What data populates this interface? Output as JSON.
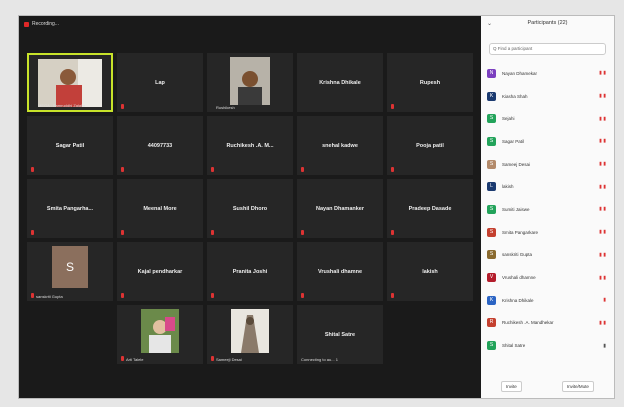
{
  "recording": {
    "label": "Recording..."
  },
  "panel": {
    "title": "Participants (22)",
    "search_placeholder": "Q Find a participant",
    "invite_label": "Invite",
    "more_label": "Invite/Mute"
  },
  "tiles": [
    {
      "name": "MEGA : Samruddhi Zalake",
      "caption": true
    },
    {
      "name": "Lap"
    },
    {
      "name": "Rushikesh",
      "caption": true
    },
    {
      "name": "Krishna Dhikale"
    },
    {
      "name": "Rupesh"
    },
    {
      "name": "Sagar Patil"
    },
    {
      "name": "44097733"
    },
    {
      "name": "Ruchikesh .A. M..."
    },
    {
      "name": "snehal kadwe"
    },
    {
      "name": "Pooja patil"
    },
    {
      "name": "Smita  Pangarha..."
    },
    {
      "name": "Meenal More"
    },
    {
      "name": "Sushil Dhoro"
    },
    {
      "name": "Nayan Dhamanker"
    },
    {
      "name": "Pradeep Dasade"
    },
    {
      "name": "sanskriti Gupta",
      "caption": true
    },
    {
      "name": "Kajal pendharkar"
    },
    {
      "name": "Pranita Joshi"
    },
    {
      "name": "Vrushali dhamne"
    },
    {
      "name": "lakish"
    },
    {
      "name": "Arti Talele",
      "caption": true
    },
    {
      "name": "Sameeji Desai",
      "caption": true
    },
    {
      "name": "Shital Satre"
    },
    {
      "name": "Connecting to au... 1",
      "caption": true
    }
  ],
  "participants": [
    {
      "name": "Nayan Dhamekar",
      "initial": "N",
      "color": "#7b3fbf"
    },
    {
      "name": "Kiasha Shah",
      "initial": "K",
      "color": "#1b3a70"
    },
    {
      "name": "Sejahi",
      "initial": "S",
      "color": "#22a35a"
    },
    {
      "name": "Sagar Patil",
      "initial": "S",
      "color": "#22a35a"
    },
    {
      "name": "Sameej Desai",
      "initial": "S",
      "color": "#b38a6a"
    },
    {
      "name": "lakish",
      "initial": "L",
      "color": "#1b3a70"
    },
    {
      "name": "Sumiti Jaiswe",
      "initial": "S",
      "color": "#22a35a"
    },
    {
      "name": "Smita Pangarkare",
      "initial": "S",
      "color": "#c4402f"
    },
    {
      "name": "sanskriti Gupta",
      "initial": "S",
      "color": "#8a6a2f"
    },
    {
      "name": "Vrushali dhamne",
      "initial": "V",
      "color": "#b31c2b"
    },
    {
      "name": "Krishna Dhikale",
      "initial": "K",
      "color": "#2b64c4"
    },
    {
      "name": "Ruchikesh .A. Mandhekar",
      "initial": "R",
      "color": "#c4402f"
    },
    {
      "name": "Shital Satre",
      "initial": "S",
      "color": "#22a35a"
    }
  ]
}
